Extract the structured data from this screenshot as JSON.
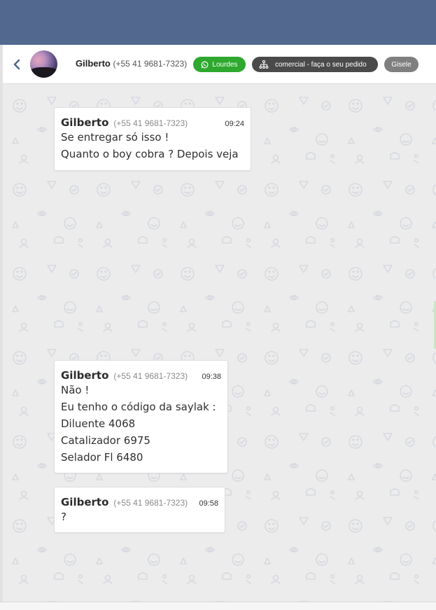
{
  "header": {
    "contact_name": "Gilberto",
    "contact_phone": "(+55 41 9681-7323)",
    "tags": [
      {
        "label": "Lourdes",
        "icon": "whatsapp-icon",
        "color": "#2ea82e"
      },
      {
        "label": "comercial - faça o seu pedido",
        "icon": "hierarchy-icon",
        "color": "#4a4a4a"
      },
      {
        "label": "Gisele",
        "color": "#7f7f7f"
      }
    ]
  },
  "messages": [
    {
      "sender": "Gilberto",
      "phone": "(+55 41 9681-7323)",
      "time": "09:24",
      "lines": [
        "Se entregar só isso !",
        "Quanto o boy cobra ? Depois veja"
      ]
    },
    {
      "sender": "Gilberto",
      "phone": "(+55 41 9681-7323)",
      "time": "09:38",
      "lines": [
        "Não !",
        "Eu tenho o código da saylak :",
        "Diluente 4068",
        "Catalizador 6975",
        "Selador Fl 6480"
      ]
    },
    {
      "sender": "Gilberto",
      "phone": "(+55 41 9681-7323)",
      "time": "09:58",
      "lines": [
        "?"
      ]
    }
  ],
  "colors": {
    "topbar": "#53688f",
    "chat_background": "#ececec",
    "bubble": "#ffffff"
  }
}
